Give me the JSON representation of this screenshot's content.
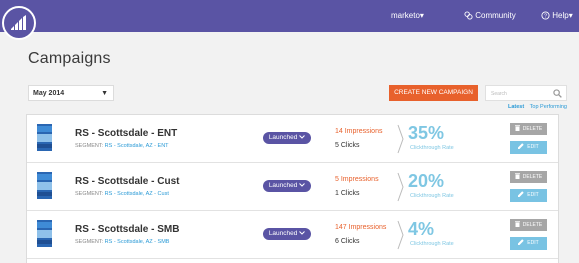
{
  "topbar": {
    "account_label": "marketo",
    "account_caret": "▾",
    "community_label": "Community",
    "help_label": "Help",
    "help_caret": "▾"
  },
  "page": {
    "title": "Campaigns"
  },
  "filters": {
    "month_value": "May 2014",
    "month_caret": "▼",
    "create_label": "CREATE NEW CAMPAIGN",
    "search_placeholder": "Search",
    "sort_latest": "Latest",
    "sort_top": "Top Performing"
  },
  "campaigns": [
    {
      "name": "RS - Scottsdale - ENT",
      "segment_label": "SEGMENT:",
      "segment_value": "RS - Scottsdale, AZ - ENT",
      "status": "Launched",
      "impressions": "14 Impressions",
      "clicks": "5 Clicks",
      "ctr": "35%",
      "ctr_label": "Clickthrough Rate",
      "delete_label": "DELETE",
      "edit_label": "EDIT"
    },
    {
      "name": "RS - Scottsdale - Cust",
      "segment_label": "SEGMENT:",
      "segment_value": "RS - Scottsdale, AZ - Cust",
      "status": "Launched",
      "impressions": "5 Impressions",
      "clicks": "1 Clicks",
      "ctr": "20%",
      "ctr_label": "Clickthrough Rate",
      "delete_label": "DELETE",
      "edit_label": "EDIT"
    },
    {
      "name": "RS - Scottsdale - SMB",
      "segment_label": "SEGMENT:",
      "segment_value": "RS - Scottsdale, AZ - SMB",
      "status": "Launched",
      "impressions": "147 Impressions",
      "clicks": "6 Clicks",
      "ctr": "4%",
      "ctr_label": "Clickthrough Rate",
      "delete_label": "DELETE",
      "edit_label": "EDIT"
    }
  ],
  "colors": {
    "brand_purple": "#5a54a4",
    "accent_orange": "#e8612c",
    "ctr_blue": "#7fc7e3",
    "link_blue": "#2a9ad6",
    "delete_gray": "#a6a6a6"
  },
  "icons": {
    "logo": "marketo-logo-icon",
    "community": "community-icon",
    "help": "help-icon",
    "search": "search-icon",
    "delete": "trash-icon",
    "edit": "pencil-icon",
    "status_caret": "chevron-down-icon",
    "metrics_brace": "brace-icon"
  }
}
